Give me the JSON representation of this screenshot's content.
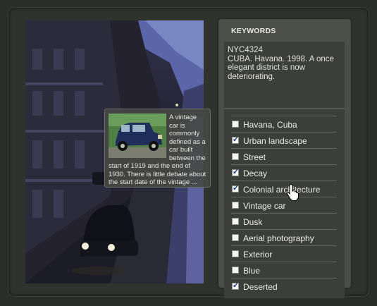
{
  "keywords_panel": {
    "title": "KEYWORDS",
    "image_id": "NYC4324",
    "description": "CUBA. Havana. 1998. A once elegant district is now deteriorating.",
    "items": [
      {
        "label": "Havana, Cuba",
        "checked": false
      },
      {
        "label": "Urban landscape",
        "checked": true
      },
      {
        "label": "Street",
        "checked": false
      },
      {
        "label": "Decay",
        "checked": true
      },
      {
        "label": "Colonial architecture",
        "checked": true
      },
      {
        "label": "Vintage car",
        "checked": false
      },
      {
        "label": "Dusk",
        "checked": false
      },
      {
        "label": "Aerial photography",
        "checked": false
      },
      {
        "label": "Exterior",
        "checked": false
      },
      {
        "label": "Blue",
        "checked": false
      },
      {
        "label": "Deserted",
        "checked": true
      }
    ]
  },
  "tooltip": {
    "text": "A vintage car is commonly defined as a car built between the start of 1919 and the end of 1930. There is little debate about the start date of the vintage ..."
  },
  "colors": {
    "accent_check": "#1d3a8a",
    "panel_bg": "#4c4e48",
    "page_bg": "#2b2d29"
  },
  "icons": {
    "cursor": "hand-pointer-icon",
    "checkbox": "checkbox-icon"
  }
}
